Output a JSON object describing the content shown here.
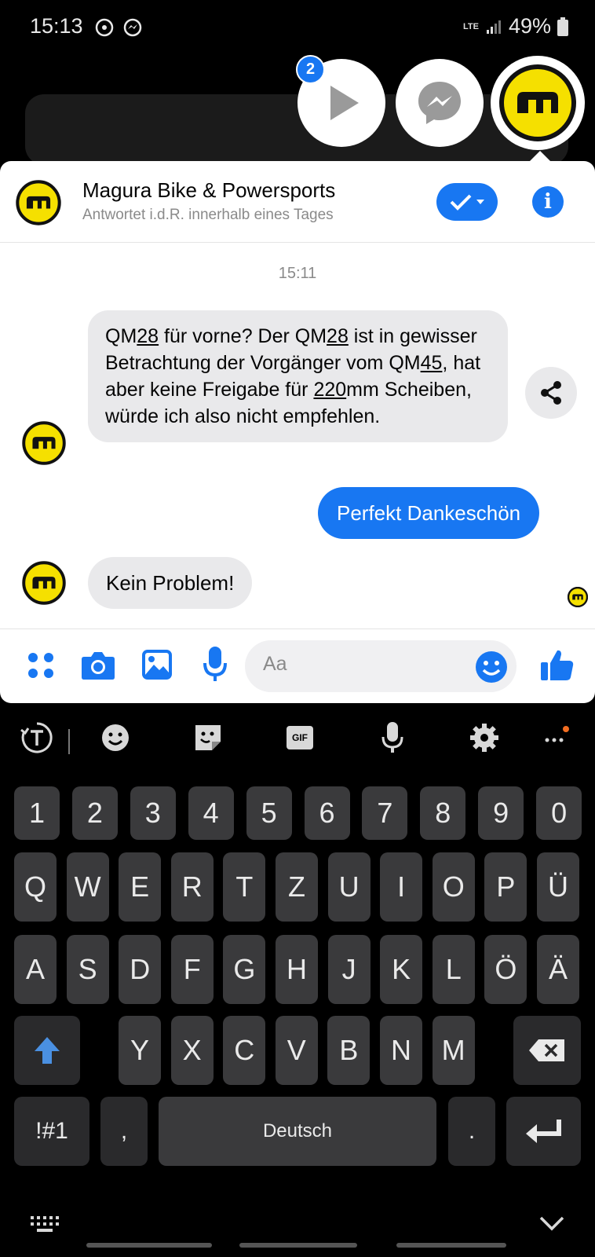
{
  "status_bar": {
    "time": "15:13",
    "network": "LTE",
    "battery": "49%"
  },
  "chat_heads": {
    "badge_count": "2"
  },
  "chat": {
    "contact_name": "Magura Bike & Powersports",
    "response_time": "Antwortet i.d.R. innerhalb eines Tages",
    "timestamp": "15:11",
    "messages": [
      {
        "direction": "incoming",
        "parts": [
          "QM",
          "28",
          " für vorne? Der QM",
          "28",
          " ist in gewisser Betrachtung der Vorgänger vom QM",
          "45",
          ", hat aber keine Freigabe für ",
          "220",
          "mm Scheiben, würde ich also nicht empfehlen."
        ]
      },
      {
        "direction": "outgoing",
        "text": "Perfekt Dankeschön"
      },
      {
        "direction": "incoming",
        "text": "Kein Problem!"
      }
    ],
    "composer_placeholder": "Aa"
  },
  "keyboard": {
    "number_row": [
      "1",
      "2",
      "3",
      "4",
      "5",
      "6",
      "7",
      "8",
      "9",
      "0"
    ],
    "row1": [
      "Q",
      "W",
      "E",
      "R",
      "T",
      "Z",
      "U",
      "I",
      "O",
      "P",
      "Ü"
    ],
    "row2": [
      "A",
      "S",
      "D",
      "F",
      "G",
      "H",
      "J",
      "K",
      "L",
      "Ö",
      "Ä"
    ],
    "row3": [
      "Y",
      "X",
      "C",
      "V",
      "B",
      "N",
      "M"
    ],
    "symbols_key": "!#1",
    "comma_key": ",",
    "space_key": "Deutsch",
    "period_key": ".",
    "gif_label": "GIF"
  },
  "colors": {
    "messenger_blue": "#1877f2",
    "magura_yellow": "#f5e000",
    "incoming_bubble": "#e9e9eb",
    "key_bg": "#3a3a3c"
  }
}
